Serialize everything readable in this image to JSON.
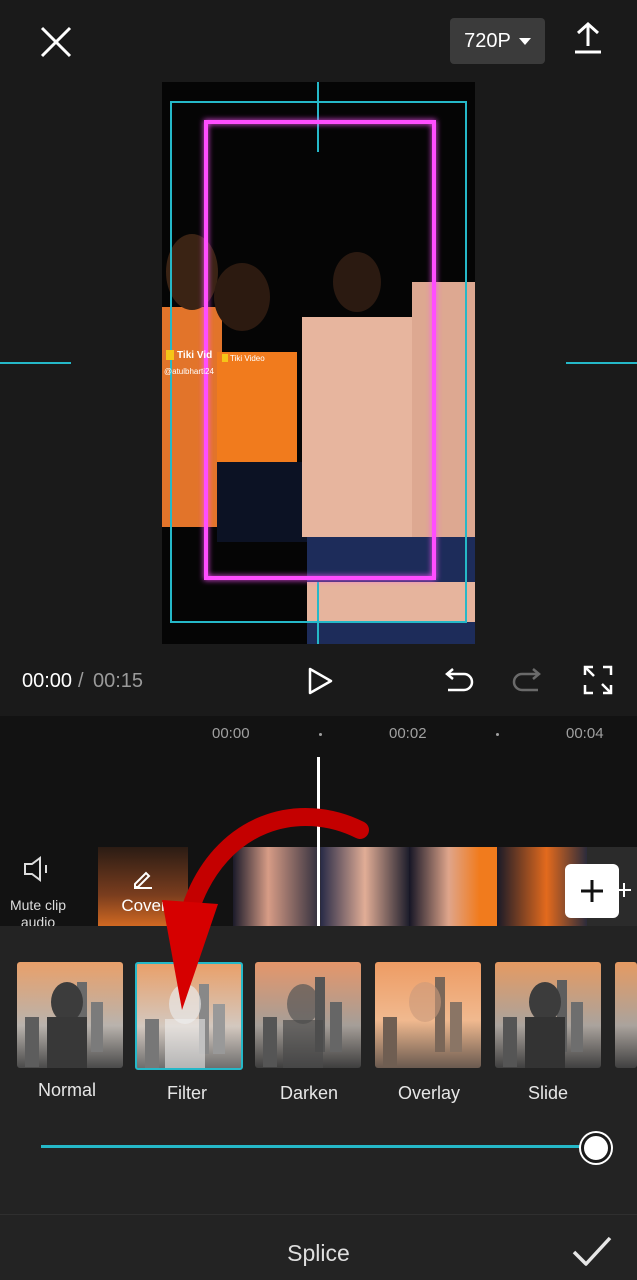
{
  "header": {
    "resolution_label": "720P",
    "close_icon": "close-icon",
    "export_icon": "upload-icon"
  },
  "preview": {
    "watermark_primary": "Tiki Vid",
    "watermark_secondary": "Tiki Video",
    "watermark_handle": "@atulbharti24"
  },
  "playback": {
    "current_time": "00:00",
    "separator": "/",
    "total_time": "00:15"
  },
  "timeline": {
    "ticks": [
      "00:00",
      "00:02",
      "00:04"
    ],
    "mute_label": "Mute clip audio",
    "cover_label": "Cover"
  },
  "transition": {
    "presets": [
      {
        "label": "Normal",
        "selected": false
      },
      {
        "label": "Filter",
        "selected": true
      },
      {
        "label": "Darken",
        "selected": false
      },
      {
        "label": "Overlay",
        "selected": false
      },
      {
        "label": "Slide",
        "selected": false
      }
    ],
    "intensity_fraction": 1.0,
    "title": "Splice"
  },
  "colors": {
    "accent": "#25b8c8",
    "frame_pink": "#ff4dff",
    "arrow_red": "#d60000"
  }
}
